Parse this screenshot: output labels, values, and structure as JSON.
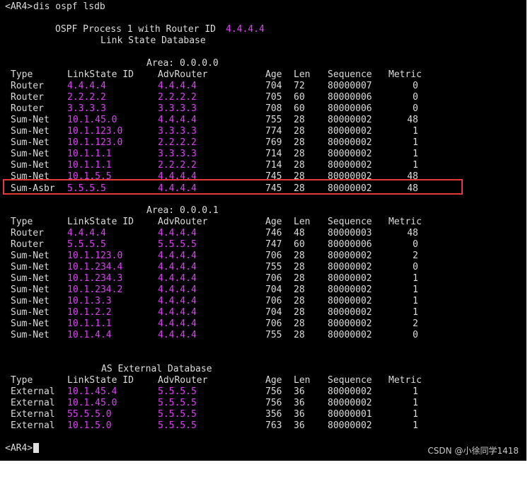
{
  "prompt": "<AR4>",
  "command": "dis ospf lsdb",
  "header": {
    "process_prefix": "OSPF Process 1 with Router ID ",
    "router_id": "4.4.4.4",
    "subtitle": "Link State Database"
  },
  "columns": {
    "type": "Type",
    "lsid": "LinkState ID",
    "adv": "AdvRouter",
    "age": "Age",
    "len": "Len",
    "seq": "Sequence",
    "metric": "Metric"
  },
  "areas": [
    {
      "title": "Area: 0.0.0.0",
      "rows": [
        {
          "type": "Router",
          "lsid": "4.4.4.4",
          "adv": "4.4.4.4",
          "age": "704",
          "len": "72",
          "seq": "80000007",
          "metric": "0"
        },
        {
          "type": "Router",
          "lsid": "2.2.2.2",
          "adv": "2.2.2.2",
          "age": "705",
          "len": "60",
          "seq": "80000006",
          "metric": "0"
        },
        {
          "type": "Router",
          "lsid": "3.3.3.3",
          "adv": "3.3.3.3",
          "age": "708",
          "len": "60",
          "seq": "80000006",
          "metric": "0"
        },
        {
          "type": "Sum-Net",
          "lsid": "10.1.45.0",
          "adv": "4.4.4.4",
          "age": "755",
          "len": "28",
          "seq": "80000002",
          "metric": "48"
        },
        {
          "type": "Sum-Net",
          "lsid": "10.1.123.0",
          "adv": "3.3.3.3",
          "age": "774",
          "len": "28",
          "seq": "80000002",
          "metric": "1"
        },
        {
          "type": "Sum-Net",
          "lsid": "10.1.123.0",
          "adv": "2.2.2.2",
          "age": "769",
          "len": "28",
          "seq": "80000002",
          "metric": "1"
        },
        {
          "type": "Sum-Net",
          "lsid": "10.1.1.1",
          "adv": "3.3.3.3",
          "age": "714",
          "len": "28",
          "seq": "80000002",
          "metric": "1"
        },
        {
          "type": "Sum-Net",
          "lsid": "10.1.1.1",
          "adv": "2.2.2.2",
          "age": "714",
          "len": "28",
          "seq": "80000002",
          "metric": "1"
        },
        {
          "type": "Sum-Net",
          "lsid": "10.1.5.5",
          "adv": "4.4.4.4",
          "age": "745",
          "len": "28",
          "seq": "80000002",
          "metric": "48"
        },
        {
          "type": "Sum-Asbr",
          "lsid": "5.5.5.5",
          "adv": "4.4.4.4",
          "age": "745",
          "len": "28",
          "seq": "80000002",
          "metric": "48"
        }
      ]
    },
    {
      "title": "Area: 0.0.0.1",
      "rows": [
        {
          "type": "Router",
          "lsid": "4.4.4.4",
          "adv": "4.4.4.4",
          "age": "746",
          "len": "48",
          "seq": "80000003",
          "metric": "48"
        },
        {
          "type": "Router",
          "lsid": "5.5.5.5",
          "adv": "5.5.5.5",
          "age": "747",
          "len": "60",
          "seq": "80000006",
          "metric": "0"
        },
        {
          "type": "Sum-Net",
          "lsid": "10.1.123.0",
          "adv": "4.4.4.4",
          "age": "706",
          "len": "28",
          "seq": "80000002",
          "metric": "2"
        },
        {
          "type": "Sum-Net",
          "lsid": "10.1.234.4",
          "adv": "4.4.4.4",
          "age": "755",
          "len": "28",
          "seq": "80000002",
          "metric": "0"
        },
        {
          "type": "Sum-Net",
          "lsid": "10.1.234.3",
          "adv": "4.4.4.4",
          "age": "706",
          "len": "28",
          "seq": "80000002",
          "metric": "1"
        },
        {
          "type": "Sum-Net",
          "lsid": "10.1.234.2",
          "adv": "4.4.4.4",
          "age": "704",
          "len": "28",
          "seq": "80000002",
          "metric": "1"
        },
        {
          "type": "Sum-Net",
          "lsid": "10.1.3.3",
          "adv": "4.4.4.4",
          "age": "706",
          "len": "28",
          "seq": "80000002",
          "metric": "1"
        },
        {
          "type": "Sum-Net",
          "lsid": "10.1.2.2",
          "adv": "4.4.4.4",
          "age": "704",
          "len": "28",
          "seq": "80000002",
          "metric": "1"
        },
        {
          "type": "Sum-Net",
          "lsid": "10.1.1.1",
          "adv": "4.4.4.4",
          "age": "706",
          "len": "28",
          "seq": "80000002",
          "metric": "2"
        },
        {
          "type": "Sum-Net",
          "lsid": "10.1.4.4",
          "adv": "4.4.4.4",
          "age": "755",
          "len": "28",
          "seq": "80000002",
          "metric": "0"
        }
      ]
    },
    {
      "title": "AS External Database",
      "rows": [
        {
          "type": "External",
          "lsid": "10.1.45.4",
          "adv": "5.5.5.5",
          "age": "756",
          "len": "36",
          "seq": "80000002",
          "metric": "1"
        },
        {
          "type": "External",
          "lsid": "10.1.45.0",
          "adv": "5.5.5.5",
          "age": "756",
          "len": "36",
          "seq": "80000002",
          "metric": "1"
        },
        {
          "type": "External",
          "lsid": "55.5.5.0",
          "adv": "5.5.5.5",
          "age": "356",
          "len": "36",
          "seq": "80000001",
          "metric": "1"
        },
        {
          "type": "External",
          "lsid": "10.1.5.0",
          "adv": "5.5.5.5",
          "age": "763",
          "len": "36",
          "seq": "80000002",
          "metric": "1"
        }
      ]
    }
  ],
  "watermark": "CSDN @小徐同学1418",
  "colors": {
    "background": "#000000",
    "text": "#dcdcdc",
    "ip_values": "#e040fb",
    "highlight_border": "#e53935"
  }
}
